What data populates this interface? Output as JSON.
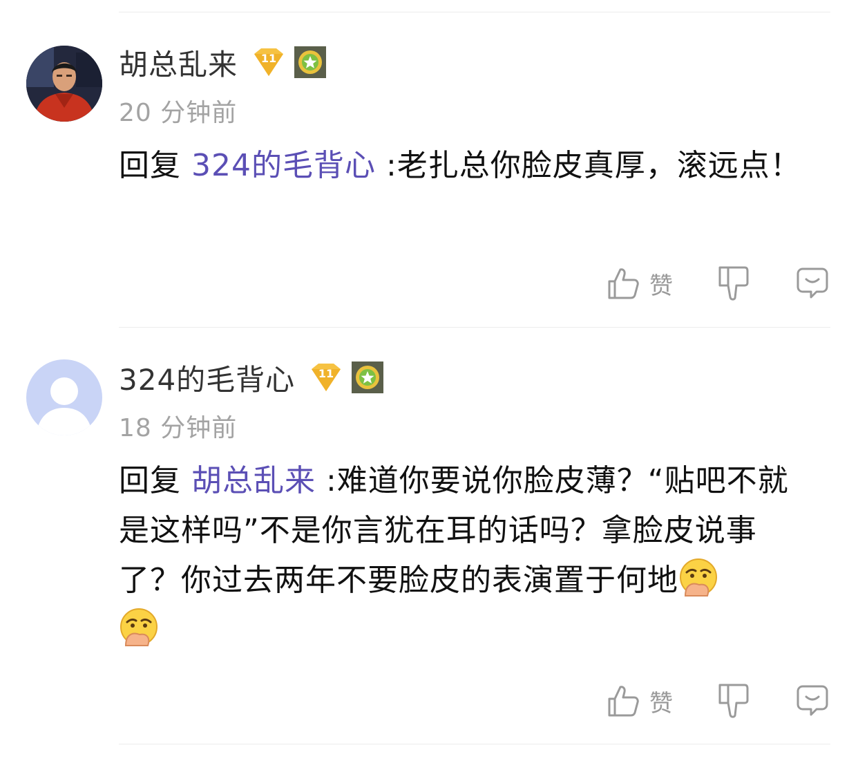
{
  "comments": [
    {
      "username": "胡总乱来",
      "level": "11",
      "time": "20 分钟前",
      "reply_prefix": "回复",
      "reply_to": "324的毛背心",
      "content": " :老扎总你脸皮真厚，滚远点！",
      "like_label": "赞"
    },
    {
      "username": "324的毛背心",
      "level": "11",
      "time": "18 分钟前",
      "reply_prefix": "回复",
      "reply_to": "胡总乱来",
      "content": " :难道你要说你脸皮薄？“贴吧不就是这样吗”不是你言犹在耳的话吗？拿脸皮说事了？你过去两年不要脸皮的表演置于何地",
      "emoji_count": 2,
      "like_label": "赞"
    }
  ],
  "colors": {
    "mention": "#5b4fb5",
    "time": "#a3a3a3",
    "icon": "#9a9a9a",
    "divider": "#ececec"
  }
}
